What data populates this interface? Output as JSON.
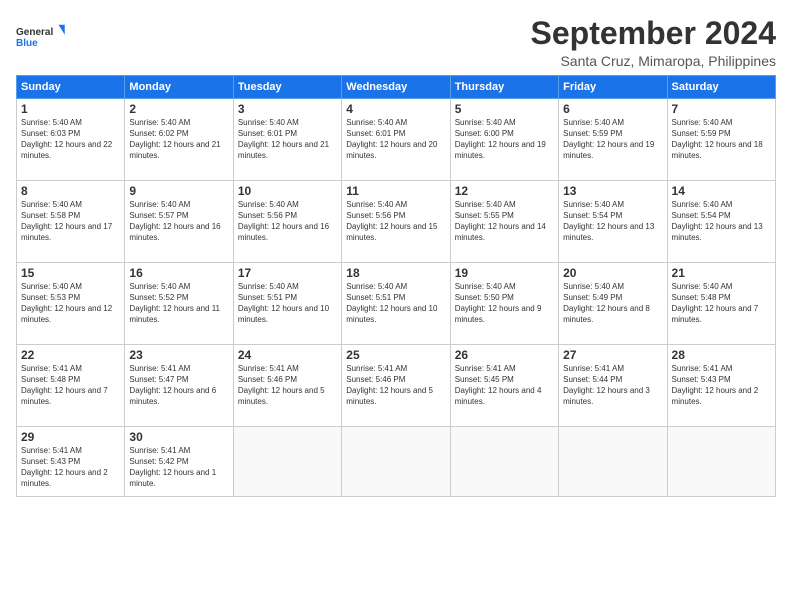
{
  "logo": {
    "line1": "General",
    "line2": "Blue"
  },
  "title": "September 2024",
  "location": "Santa Cruz, Mimaropa, Philippines",
  "days_header": [
    "Sunday",
    "Monday",
    "Tuesday",
    "Wednesday",
    "Thursday",
    "Friday",
    "Saturday"
  ],
  "weeks": [
    [
      {
        "num": "1",
        "sunrise": "5:40 AM",
        "sunset": "6:03 PM",
        "daylight": "12 hours and 22 minutes."
      },
      {
        "num": "2",
        "sunrise": "5:40 AM",
        "sunset": "6:02 PM",
        "daylight": "12 hours and 21 minutes."
      },
      {
        "num": "3",
        "sunrise": "5:40 AM",
        "sunset": "6:01 PM",
        "daylight": "12 hours and 21 minutes."
      },
      {
        "num": "4",
        "sunrise": "5:40 AM",
        "sunset": "6:01 PM",
        "daylight": "12 hours and 20 minutes."
      },
      {
        "num": "5",
        "sunrise": "5:40 AM",
        "sunset": "6:00 PM",
        "daylight": "12 hours and 19 minutes."
      },
      {
        "num": "6",
        "sunrise": "5:40 AM",
        "sunset": "5:59 PM",
        "daylight": "12 hours and 19 minutes."
      },
      {
        "num": "7",
        "sunrise": "5:40 AM",
        "sunset": "5:59 PM",
        "daylight": "12 hours and 18 minutes."
      }
    ],
    [
      {
        "num": "8",
        "sunrise": "5:40 AM",
        "sunset": "5:58 PM",
        "daylight": "12 hours and 17 minutes."
      },
      {
        "num": "9",
        "sunrise": "5:40 AM",
        "sunset": "5:57 PM",
        "daylight": "12 hours and 16 minutes."
      },
      {
        "num": "10",
        "sunrise": "5:40 AM",
        "sunset": "5:56 PM",
        "daylight": "12 hours and 16 minutes."
      },
      {
        "num": "11",
        "sunrise": "5:40 AM",
        "sunset": "5:56 PM",
        "daylight": "12 hours and 15 minutes."
      },
      {
        "num": "12",
        "sunrise": "5:40 AM",
        "sunset": "5:55 PM",
        "daylight": "12 hours and 14 minutes."
      },
      {
        "num": "13",
        "sunrise": "5:40 AM",
        "sunset": "5:54 PM",
        "daylight": "12 hours and 13 minutes."
      },
      {
        "num": "14",
        "sunrise": "5:40 AM",
        "sunset": "5:54 PM",
        "daylight": "12 hours and 13 minutes."
      }
    ],
    [
      {
        "num": "15",
        "sunrise": "5:40 AM",
        "sunset": "5:53 PM",
        "daylight": "12 hours and 12 minutes."
      },
      {
        "num": "16",
        "sunrise": "5:40 AM",
        "sunset": "5:52 PM",
        "daylight": "12 hours and 11 minutes."
      },
      {
        "num": "17",
        "sunrise": "5:40 AM",
        "sunset": "5:51 PM",
        "daylight": "12 hours and 10 minutes."
      },
      {
        "num": "18",
        "sunrise": "5:40 AM",
        "sunset": "5:51 PM",
        "daylight": "12 hours and 10 minutes."
      },
      {
        "num": "19",
        "sunrise": "5:40 AM",
        "sunset": "5:50 PM",
        "daylight": "12 hours and 9 minutes."
      },
      {
        "num": "20",
        "sunrise": "5:40 AM",
        "sunset": "5:49 PM",
        "daylight": "12 hours and 8 minutes."
      },
      {
        "num": "21",
        "sunrise": "5:40 AM",
        "sunset": "5:48 PM",
        "daylight": "12 hours and 7 minutes."
      }
    ],
    [
      {
        "num": "22",
        "sunrise": "5:41 AM",
        "sunset": "5:48 PM",
        "daylight": "12 hours and 7 minutes."
      },
      {
        "num": "23",
        "sunrise": "5:41 AM",
        "sunset": "5:47 PM",
        "daylight": "12 hours and 6 minutes."
      },
      {
        "num": "24",
        "sunrise": "5:41 AM",
        "sunset": "5:46 PM",
        "daylight": "12 hours and 5 minutes."
      },
      {
        "num": "25",
        "sunrise": "5:41 AM",
        "sunset": "5:46 PM",
        "daylight": "12 hours and 5 minutes."
      },
      {
        "num": "26",
        "sunrise": "5:41 AM",
        "sunset": "5:45 PM",
        "daylight": "12 hours and 4 minutes."
      },
      {
        "num": "27",
        "sunrise": "5:41 AM",
        "sunset": "5:44 PM",
        "daylight": "12 hours and 3 minutes."
      },
      {
        "num": "28",
        "sunrise": "5:41 AM",
        "sunset": "5:43 PM",
        "daylight": "12 hours and 2 minutes."
      }
    ],
    [
      {
        "num": "29",
        "sunrise": "5:41 AM",
        "sunset": "5:43 PM",
        "daylight": "12 hours and 2 minutes."
      },
      {
        "num": "30",
        "sunrise": "5:41 AM",
        "sunset": "5:42 PM",
        "daylight": "12 hours and 1 minute."
      },
      null,
      null,
      null,
      null,
      null
    ]
  ]
}
